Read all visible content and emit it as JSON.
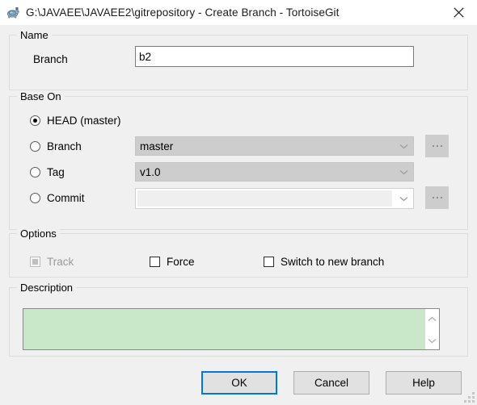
{
  "window": {
    "title": "G:\\JAVAEE\\JAVAEE2\\gitrepository - Create Branch - TortoiseGit",
    "icon": "tortoisegit-turtle-icon",
    "close_label": "✕",
    "background": "#f0f0f0",
    "titlebar_background": "#ffffff"
  },
  "name_group": {
    "legend": "Name",
    "branch_label": "Branch",
    "branch_value": "b2",
    "branch_placeholder": ""
  },
  "base_on_group": {
    "legend": "Base On",
    "selected": "head",
    "options": [
      {
        "id": "head",
        "label": "HEAD (master)",
        "checked": true
      },
      {
        "id": "branch",
        "label": "Branch",
        "checked": false
      },
      {
        "id": "tag",
        "label": "Tag",
        "checked": false
      },
      {
        "id": "commit",
        "label": "Commit",
        "checked": false
      }
    ],
    "branch_combo_value": "master",
    "tag_combo_value": "v1.0",
    "commit_combo_value": "",
    "browse_label": "...",
    "disabled_combo_color": "#cdcdcd"
  },
  "options_group": {
    "legend": "Options",
    "checkboxes": [
      {
        "id": "track",
        "label": "Track",
        "checked": false,
        "state": "indeterminate",
        "enabled": false
      },
      {
        "id": "force",
        "label": "Force",
        "checked": false,
        "state": "unchecked",
        "enabled": true
      },
      {
        "id": "switch",
        "label": "Switch to new branch",
        "checked": false,
        "state": "unchecked",
        "enabled": true
      }
    ]
  },
  "description_group": {
    "legend": "Description",
    "value": "",
    "placeholder": "",
    "background": "#c9e7c9"
  },
  "buttons": {
    "ok": "OK",
    "cancel": "Cancel",
    "help": "Help",
    "default_accent": "#0078d7"
  }
}
